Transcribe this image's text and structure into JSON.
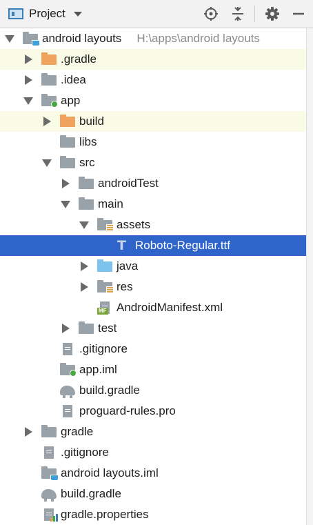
{
  "toolbar": {
    "title": "Project",
    "icons": [
      "project-view-icon",
      "locate-icon",
      "collapse-all-icon",
      "gear-icon",
      "minimize-icon"
    ]
  },
  "tree": [
    {
      "label": "android layouts",
      "path": "H:\\apps\\android layouts",
      "depth": 0,
      "arrow": "down",
      "icon": "module-folder",
      "highlight": false,
      "selected": false
    },
    {
      "label": ".gradle",
      "depth": 1,
      "arrow": "right",
      "icon": "folder-orange",
      "highlight": true,
      "selected": false
    },
    {
      "label": ".idea",
      "depth": 1,
      "arrow": "right",
      "icon": "folder-gray",
      "highlight": false,
      "selected": false
    },
    {
      "label": "app",
      "depth": 1,
      "arrow": "down",
      "icon": "app-module-folder",
      "highlight": false,
      "selected": false
    },
    {
      "label": "build",
      "depth": 2,
      "arrow": "right",
      "icon": "folder-orange",
      "highlight": true,
      "selected": false
    },
    {
      "label": "libs",
      "depth": 2,
      "arrow": "none",
      "icon": "folder-gray",
      "highlight": false,
      "selected": false
    },
    {
      "label": "src",
      "depth": 2,
      "arrow": "down",
      "icon": "folder-gray",
      "highlight": false,
      "selected": false
    },
    {
      "label": "androidTest",
      "depth": 3,
      "arrow": "right",
      "icon": "folder-gray",
      "highlight": false,
      "selected": false
    },
    {
      "label": "main",
      "depth": 3,
      "arrow": "down",
      "icon": "folder-gray",
      "highlight": false,
      "selected": false
    },
    {
      "label": "assets",
      "depth": 4,
      "arrow": "down",
      "icon": "resource-folder",
      "highlight": false,
      "selected": false
    },
    {
      "label": "Roboto-Regular.ttf",
      "depth": 5,
      "arrow": "none",
      "icon": "font-file",
      "highlight": false,
      "selected": true
    },
    {
      "label": "java",
      "depth": 4,
      "arrow": "right",
      "icon": "folder-blue",
      "highlight": false,
      "selected": false
    },
    {
      "label": "res",
      "depth": 4,
      "arrow": "right",
      "icon": "resource-folder",
      "highlight": false,
      "selected": false
    },
    {
      "label": "AndroidManifest.xml",
      "depth": 4,
      "arrow": "none",
      "icon": "manifest-file",
      "highlight": false,
      "selected": false
    },
    {
      "label": "test",
      "depth": 3,
      "arrow": "right",
      "icon": "folder-gray",
      "highlight": false,
      "selected": false
    },
    {
      "label": ".gitignore",
      "depth": 2,
      "arrow": "none",
      "icon": "text-file",
      "highlight": false,
      "selected": false
    },
    {
      "label": "app.iml",
      "depth": 2,
      "arrow": "none",
      "icon": "iml-file",
      "highlight": false,
      "selected": false
    },
    {
      "label": "build.gradle",
      "depth": 2,
      "arrow": "none",
      "icon": "gradle-file",
      "highlight": false,
      "selected": false
    },
    {
      "label": "proguard-rules.pro",
      "depth": 2,
      "arrow": "none",
      "icon": "text-file",
      "highlight": false,
      "selected": false
    },
    {
      "label": "gradle",
      "depth": 1,
      "arrow": "right",
      "icon": "folder-gray",
      "highlight": false,
      "selected": false
    },
    {
      "label": ".gitignore",
      "depth": 1,
      "arrow": "none",
      "icon": "text-file",
      "highlight": false,
      "selected": false
    },
    {
      "label": "android layouts.iml",
      "depth": 1,
      "arrow": "none",
      "icon": "module-iml-file",
      "highlight": false,
      "selected": false
    },
    {
      "label": "build.gradle",
      "depth": 1,
      "arrow": "none",
      "icon": "gradle-file",
      "highlight": false,
      "selected": false
    },
    {
      "label": "gradle.properties",
      "depth": 1,
      "arrow": "none",
      "icon": "properties-file",
      "highlight": false,
      "selected": false
    }
  ],
  "colors": {
    "selection": "#2f65ca",
    "highlight_row": "#fafbe6",
    "folder_gray": "#9aa2a9",
    "folder_orange": "#f0a35e",
    "folder_blue": "#7cc4ec",
    "path_text": "#8a8a8a"
  }
}
